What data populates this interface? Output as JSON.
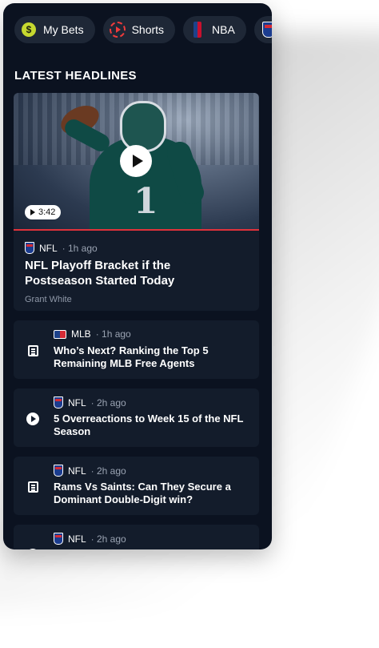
{
  "filters": [
    {
      "label": "My Bets",
      "icon": "dollar-coin-icon",
      "glyph": "$"
    },
    {
      "label": "Shorts",
      "icon": "shorts-play-icon"
    },
    {
      "label": "NBA",
      "icon": "nba-logo-icon"
    },
    {
      "label": "",
      "icon": "nfl-logo-icon"
    }
  ],
  "section_title": "LATEST HEADLINES",
  "featured": {
    "league": "NFL",
    "time": "· 1h ago",
    "title": "NFL Playoff Bracket if the Postseason Started Today",
    "author": "Grant White",
    "duration": "3:42",
    "player_number": "1"
  },
  "articles": [
    {
      "league": "MLB",
      "time": "· 1h ago",
      "title": "Who’s Next? Ranking the Top 5 Remaining MLB Free Agents",
      "type_icon": "article-icon"
    },
    {
      "league": "NFL",
      "time": "· 2h ago",
      "title": "5 Overreactions to Week 15 of the NFL Season",
      "type_icon": "video-icon"
    },
    {
      "league": "NFL",
      "time": "· 2h ago",
      "title": "Rams Vs Saints: Can They Secure a Dominant Double-Digit win?",
      "type_icon": "article-icon"
    },
    {
      "league": "NFL",
      "time": "· 2h ago",
      "title": "",
      "type_icon": "video-icon"
    }
  ],
  "colors": {
    "background": "#0b1220",
    "card": "#131c2b",
    "pill": "#1e2736",
    "accent_red": "#e0323b",
    "coin_yellow": "#c6d82f"
  }
}
